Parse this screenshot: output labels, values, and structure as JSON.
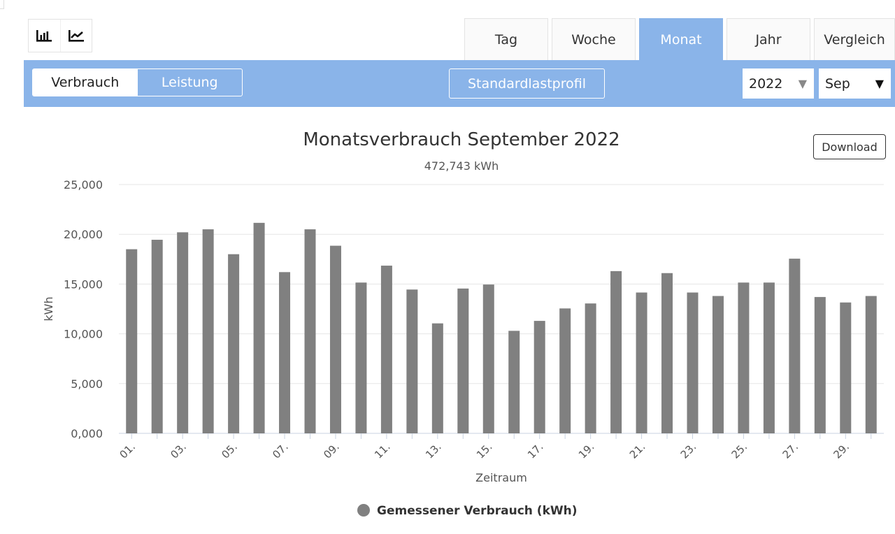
{
  "view_icons": [
    "bar-chart-icon",
    "line-chart-icon"
  ],
  "tabs": [
    {
      "label": "Tag",
      "active": false
    },
    {
      "label": "Woche",
      "active": false
    },
    {
      "label": "Monat",
      "active": true
    },
    {
      "label": "Jahr",
      "active": false
    },
    {
      "label": "Vergleich",
      "active": false
    }
  ],
  "toolbar": {
    "mode": [
      "Verbrauch",
      "Leistung"
    ],
    "active_mode": "Verbrauch",
    "profile_button": "Standardlastprofil",
    "year": "2022",
    "month": "Sep"
  },
  "download_label": "Download",
  "colors": {
    "accent": "#8ab4e9",
    "bar": "#808080"
  },
  "chart_data": {
    "type": "bar",
    "title": "Monatsverbrauch September 2022",
    "subtitle": "472,743 kWh",
    "xlabel": "Zeitraum",
    "ylabel": "kWh",
    "ylim": [
      0,
      25000
    ],
    "yticks": [
      0,
      5000,
      10000,
      15000,
      20000,
      25000
    ],
    "ytick_labels": [
      "0,000",
      "5,000",
      "10,000",
      "15,000",
      "20,000",
      "25,000"
    ],
    "categories": [
      "01.",
      "02.",
      "03.",
      "04.",
      "05.",
      "06.",
      "07.",
      "08.",
      "09.",
      "10.",
      "11.",
      "12.",
      "13.",
      "14.",
      "15.",
      "16.",
      "17.",
      "18.",
      "19.",
      "20.",
      "21.",
      "22.",
      "23.",
      "24.",
      "25.",
      "26.",
      "27.",
      "28.",
      "29.",
      "30."
    ],
    "shown_tick_labels": [
      "01.",
      "03.",
      "05.",
      "07.",
      "09.",
      "11.",
      "13.",
      "15.",
      "17.",
      "19.",
      "21.",
      "23.",
      "25.",
      "27.",
      "29."
    ],
    "series": [
      {
        "name": "Gemessener Verbrauch (kWh)",
        "color": "#808080",
        "values": [
          18500,
          19450,
          20200,
          20500,
          18000,
          21150,
          16200,
          20500,
          18850,
          15150,
          16850,
          14450,
          11050,
          14550,
          14950,
          10300,
          11300,
          12550,
          13050,
          16300,
          14150,
          16100,
          14150,
          13800,
          15150,
          15150,
          17550,
          13700,
          13150,
          13800
        ]
      }
    ],
    "legend": "bottom-center",
    "grid": true
  }
}
